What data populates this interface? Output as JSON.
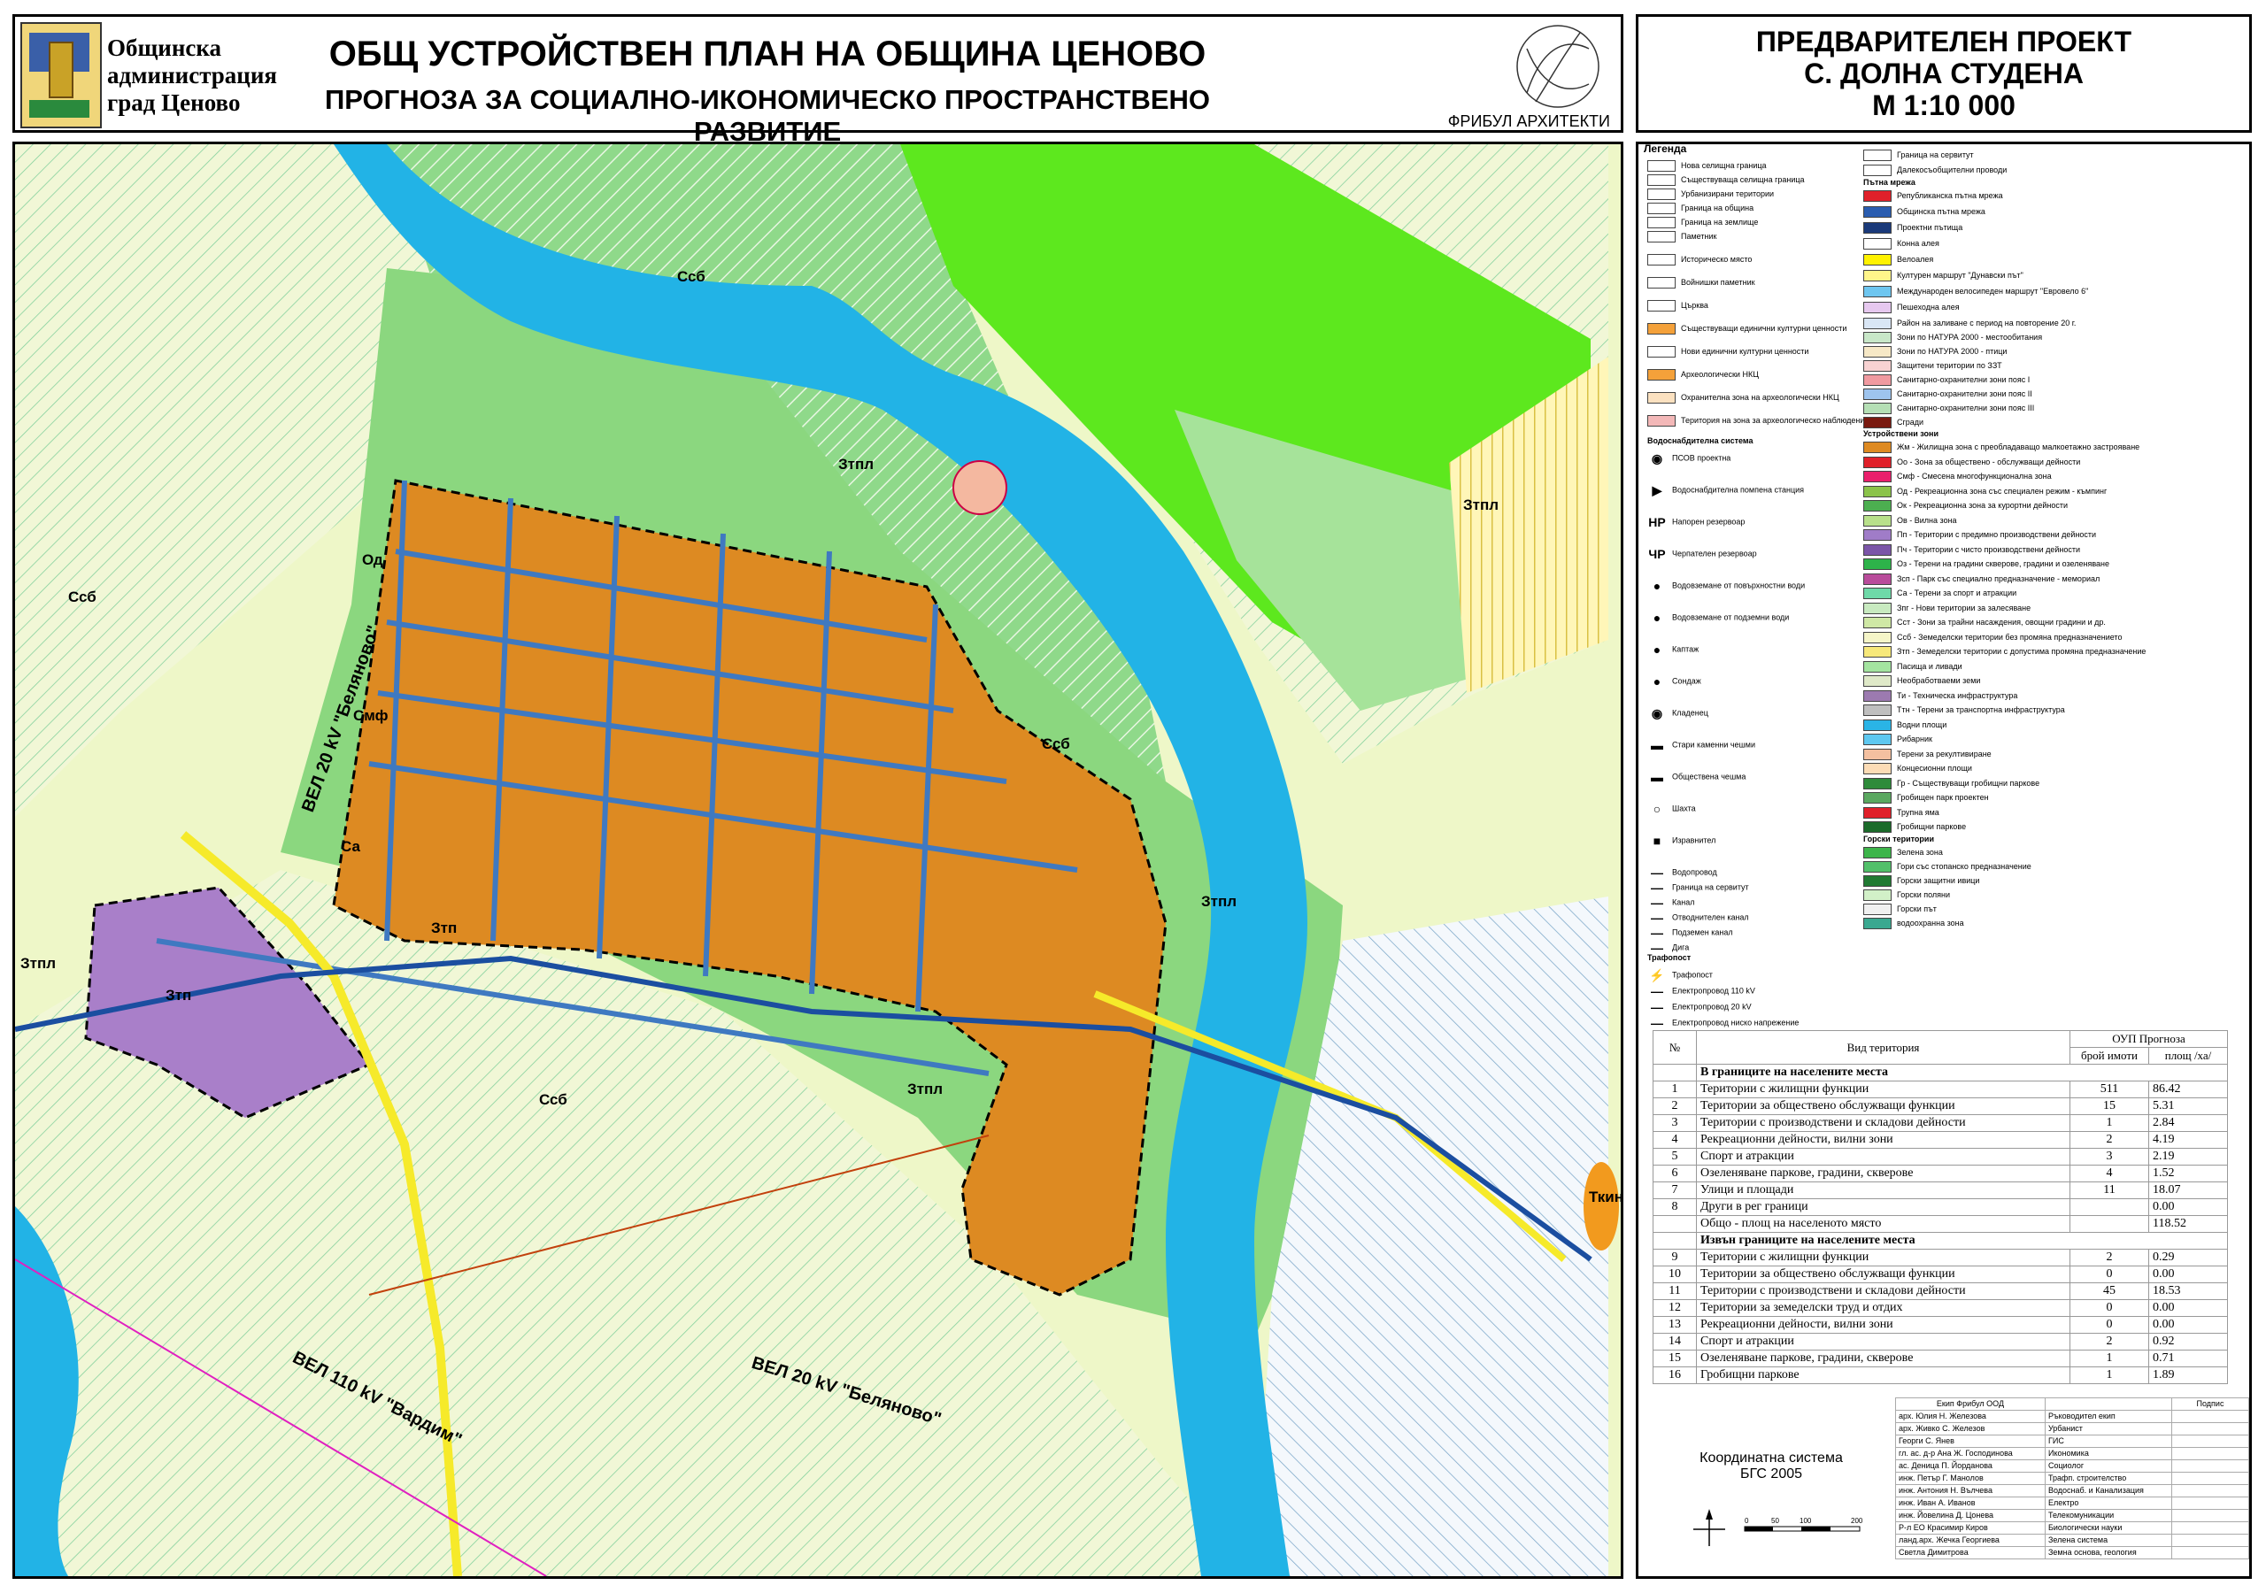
{
  "header": {
    "admin_line1": "Общинска",
    "admin_line2": "администрация",
    "admin_line3": "град Ценово",
    "title": "ОБЩ УСТРОЙСТВЕН ПЛАН НА ОБЩИНА ЦЕНОВО",
    "subtitle": "ПРОГНОЗА ЗА СОЦИАЛНО-ИКОНОМИЧЕСКО ПРОСТРАНСТВЕНО РАЗВИТИЕ",
    "logo_text": "ФРИБУЛ АРХИТЕКТИ"
  },
  "project": {
    "line1": "ПРЕДВАРИТЕЛЕН ПРОЕКТ",
    "line2": "С. ДОЛНА СТУДЕНА",
    "line3": "М 1:10 000"
  },
  "map": {
    "labels": [
      "Ссб",
      "Ссб",
      "Ссб",
      "Ссб",
      "Зтпл",
      "Зтпл",
      "Зтпл",
      "Зтпл",
      "Зтпл",
      "Зтп",
      "Зтп",
      "Смф",
      "Ткин",
      "Од",
      "Са"
    ],
    "roads": [
      "ВЕЛ 20 kV \"Беляново\"",
      "ВЕЛ 110 kV \"Вардим\"",
      "ВЕЛ 20 kV \"Беляново\""
    ]
  },
  "legend": {
    "title": "Легенда",
    "col1": [
      {
        "label": "Нова селищна граница",
        "color": "#ffffff"
      },
      {
        "label": "Съществуваща селищна граница",
        "color": "#ffffff"
      },
      {
        "label": "Урбанизирани територии",
        "color": "#ffffff"
      },
      {
        "label": "Граница на община",
        "color": "#ffffff"
      },
      {
        "label": "Граница на землище",
        "color": "#ffffff"
      },
      {
        "label": "Паметник",
        "color": "#ffffff"
      },
      {
        "label": "Историческо място",
        "color": "#ffffff"
      },
      {
        "label": "Войнишки паметник",
        "color": "#ffffff"
      },
      {
        "label": "Църква",
        "color": "#ffffff"
      },
      {
        "label": "Съществуващи единични културни ценности",
        "color": "#f4a13a"
      },
      {
        "label": "Нови единични културни ценности",
        "color": "#ffffff"
      },
      {
        "label": "Археологически НКЦ",
        "color": "#f4a13a"
      },
      {
        "label": "Охранителна зона на археологически НКЦ",
        "color": "#fbe1c0"
      },
      {
        "label": "Територия на зона за археологическо наблюдение",
        "color": "#f3b8b8"
      }
    ],
    "water_header": "Водоснабдителна система",
    "col1b": [
      {
        "label": "ПСОВ проектна",
        "icon": "◉"
      },
      {
        "label": "Водоснабдителна помпена станция",
        "icon": "▶"
      },
      {
        "label": "Напорен резервоар",
        "icon": "НР"
      },
      {
        "label": "Черпателен резервоар",
        "icon": "ЧР"
      },
      {
        "label": "Водовземане от повърхностни води",
        "icon": "●"
      },
      {
        "label": "Водовземане от подземни води",
        "icon": "●"
      },
      {
        "label": "Каптаж",
        "icon": "●"
      },
      {
        "label": "Сондаж",
        "icon": "●"
      },
      {
        "label": "Кладенец",
        "icon": "◉"
      },
      {
        "label": "Стари каменни чешми",
        "icon": "▬"
      },
      {
        "label": "Обществена чешма",
        "icon": "▬"
      },
      {
        "label": "Шахта",
        "icon": "○"
      },
      {
        "label": "Изравнител",
        "icon": "■"
      },
      {
        "label": "Водопровод",
        "icon": "—"
      },
      {
        "label": "Граница на сервитут",
        "icon": "—"
      },
      {
        "label": "Канал",
        "icon": "—"
      },
      {
        "label": "Отводнителен канал",
        "icon": "—"
      },
      {
        "label": "Подземен канал",
        "icon": "—"
      },
      {
        "label": "Дига",
        "icon": "—"
      }
    ],
    "trafo_header": "Трафопост",
    "col1c": [
      {
        "label": "Трафопост",
        "icon": "⚡"
      },
      {
        "label": "Електропровод 110 kV",
        "icon": "—"
      },
      {
        "label": "Електропровод 20 kV",
        "icon": "—"
      },
      {
        "label": "Електропровод ниско напрежение",
        "icon": "—"
      }
    ],
    "col2_top": [
      {
        "label": "Граница на сервитут",
        "color": "#ffffff"
      },
      {
        "label": "Далекосъобщителни проводи",
        "color": "#ffffff"
      }
    ],
    "road_header": "Пътна мрежа",
    "col2_roads": [
      {
        "label": "Републиканска пътна мрежа",
        "color": "#e0202a"
      },
      {
        "label": "Общинска пътна мрежа",
        "color": "#2a5db0"
      },
      {
        "label": "Проектни пътища",
        "color": "#1b3a7a"
      },
      {
        "label": "Конна алея",
        "color": "#ffffff"
      },
      {
        "label": "Велоалея",
        "color": "#fff200"
      },
      {
        "label": "Културен маршрут \"Дунавски път\"",
        "color": "#fff58a"
      },
      {
        "label": "Международен велосипеден маршрут \"Евровело 6\"",
        "color": "#6ec6f0"
      },
      {
        "label": "Пешеходна алея",
        "color": "#e6c8ef"
      },
      {
        "label": "Район на заливане с период на повторение 20 г.",
        "color": "#d9e6f5"
      },
      {
        "label": "Зони по НАТУРА 2000 - местообитания",
        "color": "#c8e7c8"
      },
      {
        "label": "Зони по НАТУРА 2000 - птици",
        "color": "#f6e8c6"
      },
      {
        "label": "Защитени територии по ЗЗТ",
        "color": "#f8d2d2"
      },
      {
        "label": "Санитарно-охранителни зони пояс I",
        "color": "#f09aa0"
      },
      {
        "label": "Санитарно-охранителни зони пояс II",
        "color": "#9ec4ee"
      },
      {
        "label": "Санитарно-охранителни зони пояс III",
        "color": "#b5dfb5"
      },
      {
        "label": "Сгради",
        "color": "#7a1a10"
      }
    ],
    "zone_header": "Устройствени зони",
    "col2_zones": [
      {
        "label": "Жм - Жилищна зона с преобладаващо малкоетажно застрояване",
        "color": "#de8a22"
      },
      {
        "label": "Оо - Зона за обществено - обслужващи дейности",
        "color": "#e0202a"
      },
      {
        "label": "Смф - Смесена многофункционална зона",
        "color": "#ea1f6c"
      },
      {
        "label": "Од - Рекреационна зона със специален режим - къмпинг",
        "color": "#8bc34a"
      },
      {
        "label": "Ок - Рекреационна зона за курортни дейности",
        "color": "#4caf50"
      },
      {
        "label": "Ов - Вилна зона",
        "color": "#b8e08a"
      },
      {
        "label": "Пп - Територии с предимно производствени дейности",
        "color": "#a07cc8"
      },
      {
        "label": "Пч - Територии с чисто производствени дейности",
        "color": "#7b55a8"
      },
      {
        "label": "Оз - Терени на градини скверове, градини и озеленяване",
        "color": "#2db34a"
      },
      {
        "label": "Зсп - Парк със специално предназначение - мемориал",
        "color": "#b94c9b"
      },
      {
        "label": "Са - Терени за спорт и атракции",
        "color": "#6ed9a8"
      },
      {
        "label": "Зпг - Нови територии за залесяване",
        "color": "#c8eac0"
      },
      {
        "label": "Сст - Зони за трайни насаждения, овощни градини и др.",
        "color": "#cfe8a5"
      },
      {
        "label": "Ссб - Земеделски територии без промяна предназначението",
        "color": "#f5f5c8"
      },
      {
        "label": "Зтп - Земеделски територии с допустима промяна предназначение",
        "color": "#f7e87a"
      },
      {
        "label": "Пасища и ливади",
        "color": "#a4e4a0"
      },
      {
        "label": "Необработваеми земи",
        "color": "#dfe9c8"
      },
      {
        "label": "Ти - Техническа инфраструктура",
        "color": "#9c7ab0"
      },
      {
        "label": "Ттн - Терени за транспортна инфраструктура",
        "color": "#bfbfbf"
      },
      {
        "label": "Водни площи",
        "color": "#2ab4e6"
      },
      {
        "label": "Рибарник",
        "color": "#5ec8f0"
      },
      {
        "label": "Терени за рекултивиране",
        "color": "#f4c0a0"
      },
      {
        "label": "Концесионни площи",
        "color": "#fcdcb6"
      },
      {
        "label": "Гр - Съществуващи гробищни паркове",
        "color": "#2e8b3a"
      },
      {
        "label": "Гробищен парк проектен",
        "color": "#5aa860"
      },
      {
        "label": "Трупна яма",
        "color": "#e0202a"
      },
      {
        "label": "Гробищни паркове",
        "color": "#1b6b2a"
      }
    ],
    "forest_header": "Горски територии",
    "col2_forest": [
      {
        "label": "Зелена зона",
        "color": "#3db54a"
      },
      {
        "label": "Гори със стопанско предназначение",
        "color": "#52c06a"
      },
      {
        "label": "Горски защитни ивици",
        "color": "#217a33"
      },
      {
        "label": "Горски поляни",
        "color": "#d2f0c8"
      },
      {
        "label": "Горски път",
        "color": "#f0f0f0"
      },
      {
        "label": "водоохранна зона",
        "color": "#3aa890"
      }
    ]
  },
  "table": {
    "h_num": "№",
    "h_type": "Вид територия",
    "h_group": "ОУП Прогноза",
    "h_props": "брой имоти",
    "h_area": "площ /ха/",
    "section1": "В границите на населените места",
    "rows1": [
      {
        "n": "1",
        "type": "Територии с жилищни функции",
        "props": "511",
        "area": "86.42"
      },
      {
        "n": "2",
        "type": "Територии за обществено обслужващи функции",
        "props": "15",
        "area": "5.31"
      },
      {
        "n": "3",
        "type": "Територии с производствени и складови дейности",
        "props": "1",
        "area": "2.84"
      },
      {
        "n": "4",
        "type": "Рекреационни дейности, вилни зони",
        "props": "2",
        "area": "4.19"
      },
      {
        "n": "5",
        "type": "Спорт и атракции",
        "props": "3",
        "area": "2.19"
      },
      {
        "n": "6",
        "type": "Озеленяване паркове, градини, скверове",
        "props": "4",
        "area": "1.52"
      },
      {
        "n": "7",
        "type": "Улици и площади",
        "props": "11",
        "area": "18.07"
      },
      {
        "n": "8",
        "type": "Други в рег граници",
        "props": "",
        "area": "0.00"
      },
      {
        "n": "",
        "type": "Общо - площ на населеното място",
        "props": "",
        "area": "118.52"
      }
    ],
    "section2": "Извън границите на населените места",
    "rows2": [
      {
        "n": "9",
        "type": "Територии с жилищни функции",
        "props": "2",
        "area": "0.29"
      },
      {
        "n": "10",
        "type": "Територии за обществено обслужващи функции",
        "props": "0",
        "area": "0.00"
      },
      {
        "n": "11",
        "type": "Територии с производствени и складови дейности",
        "props": "45",
        "area": "18.53"
      },
      {
        "n": "12",
        "type": "Територии за земеделски труд и отдих",
        "props": "0",
        "area": "0.00"
      },
      {
        "n": "13",
        "type": "Рекреационни дейности, вилни зони",
        "props": "0",
        "area": "0.00"
      },
      {
        "n": "14",
        "type": "Спорт и атракции",
        "props": "2",
        "area": "0.92"
      },
      {
        "n": "15",
        "type": "Озеленяване паркове, градини, скверове",
        "props": "1",
        "area": "0.71"
      },
      {
        "n": "16",
        "type": "Гробищни паркове",
        "props": "1",
        "area": "1.89"
      }
    ]
  },
  "team": {
    "header_team": "Екип Фрибул ООД",
    "header_sign": "Подпис",
    "rows": [
      {
        "name": "арх. Юлия Н. Железова",
        "role": "Ръководител екип"
      },
      {
        "name": "арх. Живко С. Железов",
        "role": "Урбанист"
      },
      {
        "name": "Георги С. Янев",
        "role": "ГИС"
      },
      {
        "name": "гл. ас. д-р Ана Ж. Господинова",
        "role": "Икономика"
      },
      {
        "name": "ас. Деница П. Йорданова",
        "role": "Социолог"
      },
      {
        "name": "инж. Петър Г. Манолов",
        "role": "Трафп. строителство"
      },
      {
        "name": "инж. Антония Н. Вълчева",
        "role": "Водоснаб. и Канализация"
      },
      {
        "name": "инж. Иван А. Иванов",
        "role": "Електро"
      },
      {
        "name": "инж. Йовелина Д. Цонева",
        "role": "Телекомуникации"
      },
      {
        "name": "Р-л ЕО Красимир Киров",
        "role": "Биологически науки"
      },
      {
        "name": "ланд.арх. Жечка Георгиева",
        "role": "Зелена система"
      },
      {
        "name": "Светла Димитрова",
        "role": "Земна основа, геология"
      }
    ]
  },
  "coord": {
    "line1": "Координатна система",
    "line2": "БГС 2005",
    "scale_ticks": [
      "0",
      "50",
      "100",
      "200"
    ]
  }
}
